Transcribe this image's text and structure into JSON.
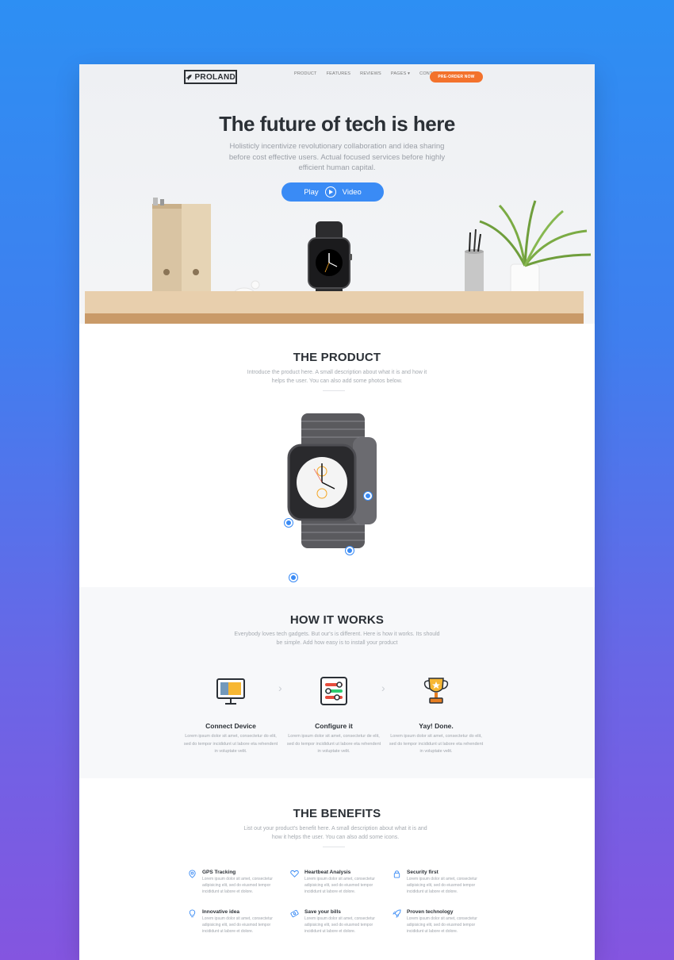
{
  "brand": {
    "logo_text": "PROLAND"
  },
  "nav": {
    "items": [
      "PRODUCT",
      "FEATURES",
      "REVIEWS",
      "PAGES ▾",
      "CONTACT"
    ],
    "cta_label": "PRE-ORDER NOW"
  },
  "hero": {
    "title": "The future of tech is here",
    "subtitle": "Holisticly incentivize revolutionary collaboration and idea sharing before cost effective users. Actual focused services before highly efficient human capital.",
    "play_label": "Play",
    "video_label": "Video"
  },
  "product": {
    "title": "THE PRODUCT",
    "subtitle": "Introduce the product here. A small description about what it is and how it helps the user. You can also add some photos below."
  },
  "how": {
    "title": "HOW IT WORKS",
    "subtitle": "Everybody loves tech gadgets. But our's is different. Here is how it works. Its should be simple. Add how easy is to install your product",
    "steps": [
      {
        "title": "Connect Device",
        "text": "Lorem ipsum dolor sit amet, consectetur do elit, sed do tempor incididunt ut labore eta rehendent in voluptate velit.",
        "icon": "monitor-icon"
      },
      {
        "title": "Configure it",
        "text": "Lorem ipsum dolor sit amet, consectetur de elit, sed do tempor incididunt ut labore eta rehendent in voluptate velit.",
        "icon": "settings-toggles-icon"
      },
      {
        "title": "Yay! Done.",
        "text": "Lorem ipsum dolor sit amet, consectetur do elit, sed do tempor incididunt ut labore eta rehendent in voluptate velit.",
        "icon": "trophy-icon"
      }
    ]
  },
  "benefits": {
    "title": "THE BENEFITS",
    "subtitle": "List out your product's benefit here. A small description about what it is and how it helps the user. You can also add some icons.",
    "items": [
      {
        "title": "GPS Tracking",
        "text": "Lorem ipsum dolor sit amet, consectetur adipisicing elit, sed do eiusmod tempor incididunt ut labore et dolore.",
        "icon": "map-pin-icon"
      },
      {
        "title": "Heartbeat Analysis",
        "text": "Lorem ipsum dolor sit amet, consectetur adipisicing elit, sed do eiusmod tempor incididunt ut labore et dolore.",
        "icon": "heart-icon"
      },
      {
        "title": "Security first",
        "text": "Lorem ipsum dolor sit amet, consectetur adipisicing elit, sed do eiusmod tempor incididunt ut labore et dolore.",
        "icon": "lock-icon"
      },
      {
        "title": "Innovative idea",
        "text": "Lorem ipsum dolor sit amet, consectetur adipisicing elit, sed do eiusmod tempor incididunt ut labore et dolore.",
        "icon": "lightbulb-icon"
      },
      {
        "title": "Save your bills",
        "text": "Lorem ipsum dolor sit amet, consectetur adipisicing elit, sed do eiusmod tempor incididunt ut labore et dolore.",
        "icon": "money-icon"
      },
      {
        "title": "Proven technology",
        "text": "Lorem ipsum dolor sit amet, consectetur adipisicing elit, sed do eiusmod tempor incididunt ut labore et dolore.",
        "icon": "rocket-icon"
      }
    ]
  },
  "colors": {
    "accent": "#3a8bf5",
    "cta": "#f3722c",
    "heading": "#2b3036"
  }
}
